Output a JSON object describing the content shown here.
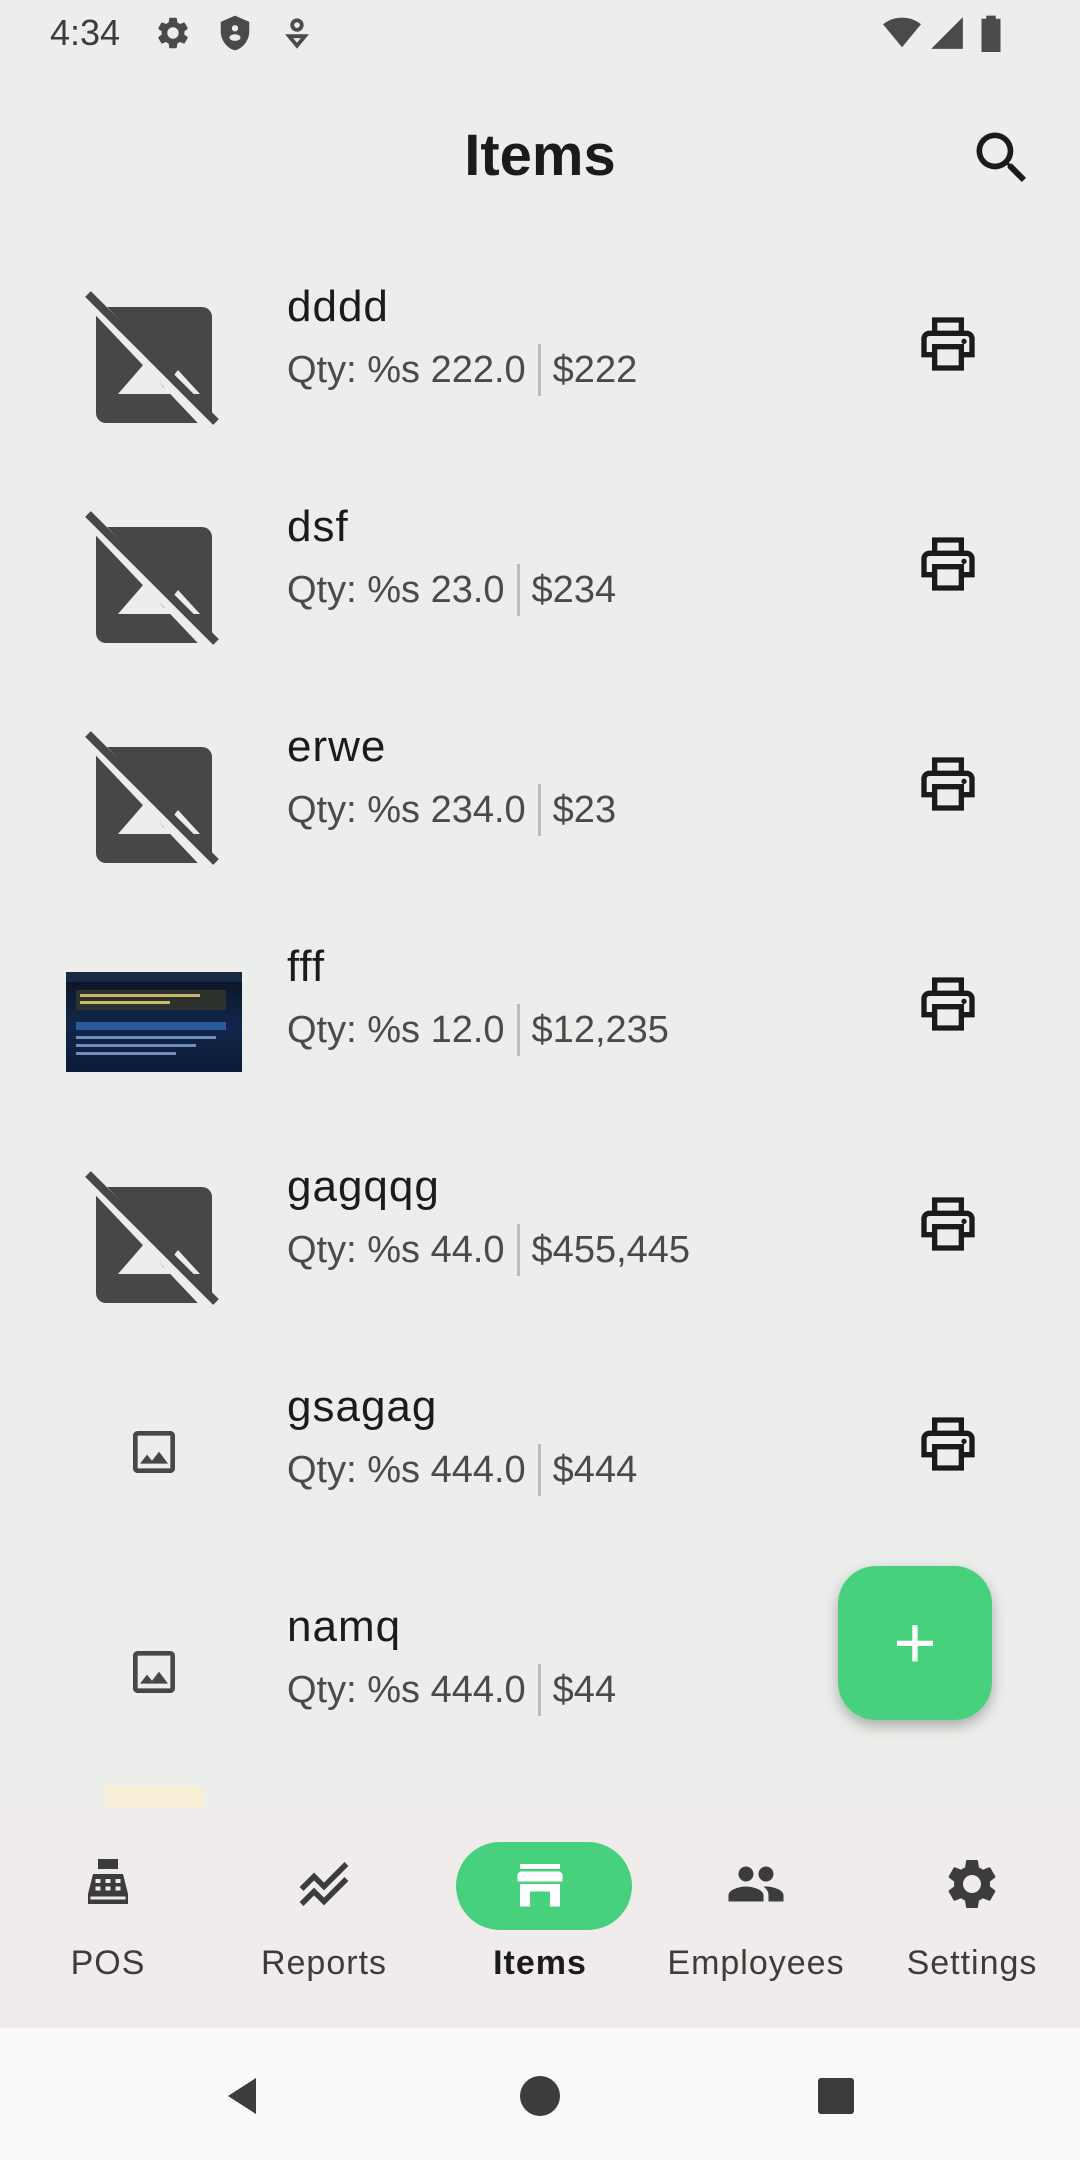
{
  "status_bar": {
    "time": "4:34"
  },
  "header": {
    "title": "Items"
  },
  "items": [
    {
      "name": "dddd",
      "qty": "Qty: %s 222.0",
      "price": "$222",
      "image": "broken-image"
    },
    {
      "name": "dsf",
      "qty": "Qty: %s 23.0",
      "price": "$234",
      "image": "broken-image"
    },
    {
      "name": "erwe",
      "qty": "Qty: %s 234.0",
      "price": "$23",
      "image": "broken-image"
    },
    {
      "name": "fff",
      "qty": "Qty: %s 12.0",
      "price": "$12,235",
      "image": "photo"
    },
    {
      "name": "gagqqg",
      "qty": "Qty: %s 44.0",
      "price": "$455,445",
      "image": "broken-image"
    },
    {
      "name": "gsagag",
      "qty": "Qty: %s 444.0",
      "price": "$444",
      "image": "image-placeholder"
    },
    {
      "name": "namq",
      "qty": "Qty: %s 444.0",
      "price": "$44",
      "image": "image-placeholder"
    }
  ],
  "fab": {
    "label": "+"
  },
  "bottom_nav": [
    {
      "label": "POS",
      "icon": "cash-register-icon",
      "active": false
    },
    {
      "label": "Reports",
      "icon": "trend-icon",
      "active": false
    },
    {
      "label": "Items",
      "icon": "store-icon",
      "active": true
    },
    {
      "label": "Employees",
      "icon": "people-icon",
      "active": false
    },
    {
      "label": "Settings",
      "icon": "gear-icon",
      "active": false
    }
  ],
  "colors": {
    "accent": "#48d17c",
    "background": "#eceeeb",
    "nav_background": "#f0eceb"
  }
}
